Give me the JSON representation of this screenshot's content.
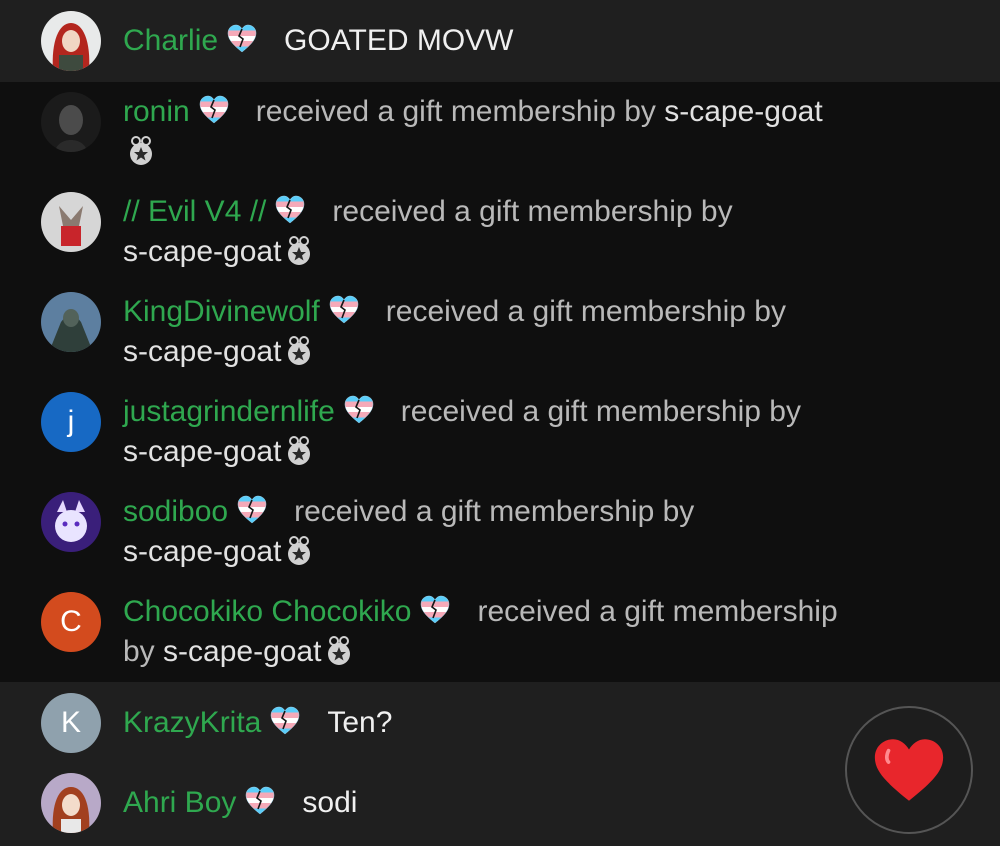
{
  "chat": {
    "top_message": {
      "name": "Charlie",
      "text": "GOATED MOVW"
    },
    "gifts": [
      {
        "name": "ronin",
        "action": "received a gift membership by",
        "giver": "s-cape-goat"
      },
      {
        "name": "// Evil V4 //",
        "action": "received a gift membership by",
        "giver": "s-cape-goat"
      },
      {
        "name": "KingDivinewolf",
        "action": "received a gift membership by",
        "giver": "s-cape-goat"
      },
      {
        "name": "justagrindernlife",
        "action": "received a gift membership by",
        "giver": "s-cape-goat",
        "avatar_letter": "j"
      },
      {
        "name": "sodiboo",
        "action": "received a gift membership by",
        "giver": "s-cape-goat"
      },
      {
        "name": "Chocokiko Chocokiko",
        "action": "received a gift membership",
        "action2": "by",
        "giver": "s-cape-goat",
        "avatar_letter": "C"
      }
    ],
    "messages": [
      {
        "name": "KrazyKrita",
        "text": "Ten?",
        "avatar_letter": "K"
      },
      {
        "name": "Ahri Boy",
        "text": "sodi"
      }
    ]
  },
  "colors": {
    "username": "#2fa84f",
    "gift_row_bg": "#0f0f0f",
    "message_row_bg": "#1f1f1f",
    "heart": "#e8262c"
  },
  "icons": {
    "badge": "trans-flag-heart-icon",
    "gift": "gift-badge-icon",
    "reaction": "heart-icon"
  }
}
